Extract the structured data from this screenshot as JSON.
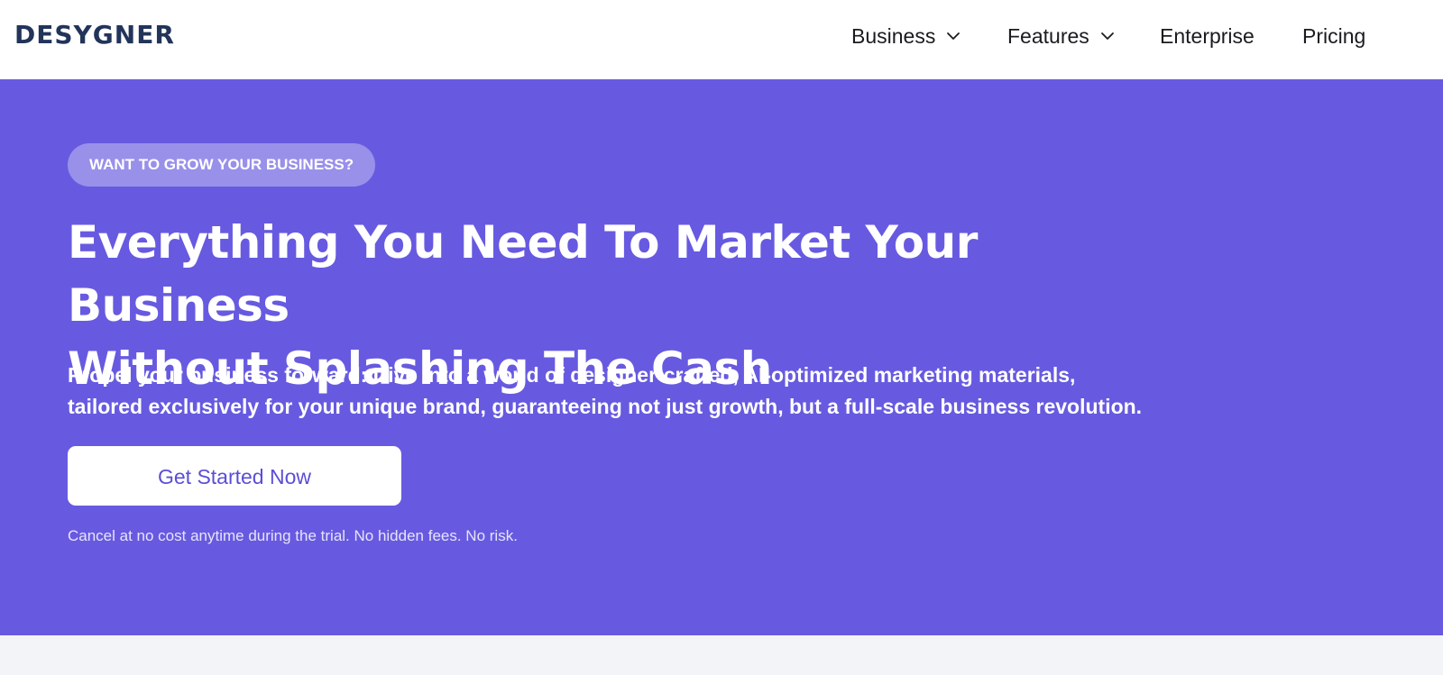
{
  "header": {
    "logo": "DESYGNER",
    "nav": [
      {
        "label": "Business",
        "icon": "chevron-down-icon"
      },
      {
        "label": "Features",
        "icon": "chevron-down-icon"
      },
      {
        "label": "Enterprise"
      },
      {
        "label": "Pricing"
      }
    ]
  },
  "hero": {
    "eyebrow": "WANT TO GROW YOUR BUSINESS?",
    "headline_line1": "Everything You Need To Market Your Business",
    "headline_line2": "Without Splashing The Cash",
    "subtext_line1": "Propel your business forward: Dive into a world of designer-crafted, AI-optimized marketing materials,",
    "subtext_line2": "tailored exclusively for your unique brand, guaranteeing not just growth, but a full-scale business revolution.",
    "cta_label": "Get Started Now",
    "disclaimer": "Cancel at no cost anytime during the trial. No hidden fees. No risk."
  },
  "colors": {
    "brand_navy": "#22345a",
    "hero_background": "#675ae0",
    "cta_text": "#5b4ed6",
    "page_background": "#f2f4f8"
  }
}
